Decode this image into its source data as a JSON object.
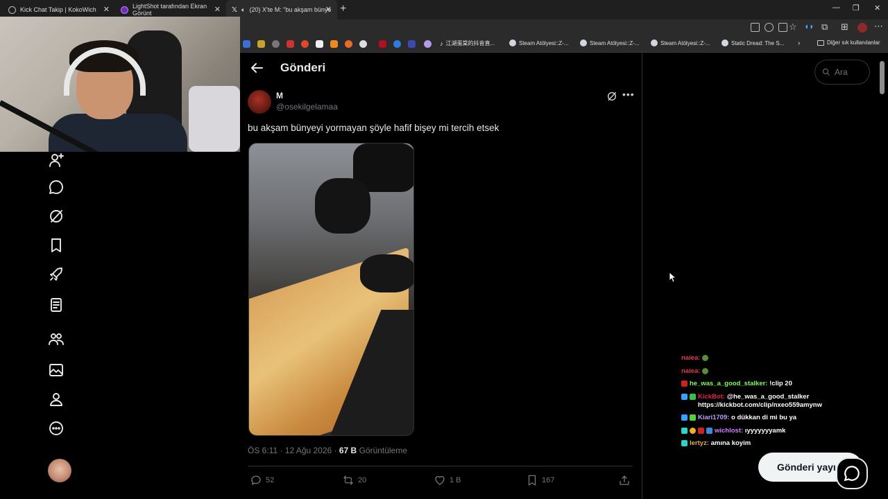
{
  "browser": {
    "tabs": [
      {
        "title": "Kick Chat Takip | KokoWich"
      },
      {
        "title": "LightShot tarafından Ekran Görünt"
      },
      {
        "title": "(20) X'te M: \"bu akşam bünye"
      }
    ],
    "bookmarks": [
      {
        "label": "江湖蛋棠的抖音直..."
      },
      {
        "label": "Steam Atölyesi::Z-..."
      },
      {
        "label": "Steam Atölyesi::Z-..."
      },
      {
        "label": "Steam Atölyesi::Z-..."
      },
      {
        "label": "Static Dread: The S..."
      }
    ],
    "other_bookmarks": "Diğer sık kullanılanlar"
  },
  "header": {
    "title": "Gönderi"
  },
  "post": {
    "name": "M",
    "handle": "@osekilgelamaa",
    "text": "bu akşam bünyeyi yormayan şöyle hafif bişey mi tercih etsek",
    "time": "ÖS 6:11 · 12 Ağu 2026 · ",
    "views_count": "67 B",
    "views_label": " Görüntüleme",
    "replies": "52",
    "reposts": "20",
    "likes": "1 B",
    "bookmarks": "167"
  },
  "search": {
    "placeholder": "Ara"
  },
  "chat": [
    {
      "user": "naiea:",
      "text": "",
      "color": "#e53950"
    },
    {
      "user": "naiea:",
      "text": "",
      "color": "#e53950"
    },
    {
      "user": "he_was_a_good_stalker:",
      "text": " !clip 20",
      "color": "#7cfc58"
    },
    {
      "user": "KickBot:",
      "text": " @he_was_a_good_stalker https://kickbot.com/clip/nxeo559amynw",
      "color": "#e0204f"
    },
    {
      "user": "Kiari1709:",
      "text": " o dükkan di mi bu ya",
      "color": "#c49bff"
    },
    {
      "user": "wichlost:",
      "text": " ıyyyyyyyamk",
      "color": "#d47cff"
    },
    {
      "user": "lertyz:",
      "text": " amına koyim",
      "color": "#e0b04a"
    }
  ],
  "post_button": "Gönderi yayı"
}
